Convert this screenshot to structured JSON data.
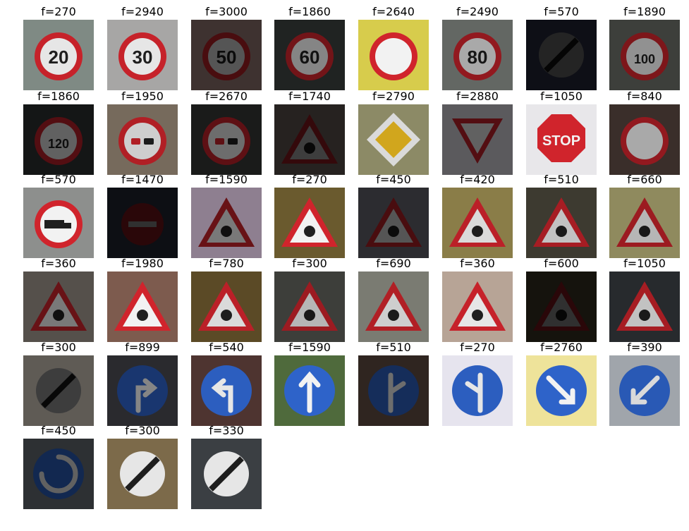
{
  "figure": {
    "images": [
      {
        "label": "f=270",
        "sign": "speed-limit-20",
        "text": "20",
        "bg": "#7f8a84",
        "light": 0.95
      },
      {
        "label": "f=2940",
        "sign": "speed-limit-30",
        "text": "30",
        "bg": "#a7a6a5",
        "light": 0.95
      },
      {
        "label": "f=3000",
        "sign": "speed-limit-50",
        "text": "50",
        "bg": "#3e3230",
        "light": 0.35
      },
      {
        "label": "f=1860",
        "sign": "speed-limit-60",
        "text": "60",
        "bg": "#202322",
        "light": 0.55
      },
      {
        "label": "f=2640",
        "sign": "speed-limit-70",
        "text": "",
        "bg": "#d7cc4c",
        "light": 1.0
      },
      {
        "label": "f=2490",
        "sign": "speed-limit-80",
        "text": "80",
        "bg": "#636763",
        "light": 0.7
      },
      {
        "label": "f=570",
        "sign": "end-speed-limit",
        "text": "",
        "bg": "#0e0f16",
        "light": 0.15
      },
      {
        "label": "f=1890",
        "sign": "speed-limit-100",
        "text": "100",
        "bg": "#3d3f3b",
        "light": 0.6
      },
      {
        "label": "f=1860",
        "sign": "speed-limit-120",
        "text": "120",
        "bg": "#141616",
        "light": 0.4
      },
      {
        "label": "f=1950",
        "sign": "no-overtaking",
        "text": "",
        "bg": "#766a5c",
        "light": 0.85
      },
      {
        "label": "f=2670",
        "sign": "no-overtaking-trucks",
        "text": "",
        "bg": "#1a1b1a",
        "light": 0.45
      },
      {
        "label": "f=1740",
        "sign": "warning-triangle",
        "text": "",
        "bg": "#262220",
        "light": 0.25
      },
      {
        "label": "f=2790",
        "sign": "priority-road",
        "text": "",
        "bg": "#8c8a66",
        "light": 0.9
      },
      {
        "label": "f=2880",
        "sign": "yield",
        "text": "",
        "bg": "#5b5a5d",
        "light": 0.4
      },
      {
        "label": "f=1050",
        "sign": "stop",
        "text": "STOP",
        "bg": "#e8e7ea",
        "light": 1.0
      },
      {
        "label": "f=840",
        "sign": "no-vehicles",
        "text": "",
        "bg": "#3a2e2a",
        "light": 0.7
      },
      {
        "label": "f=570",
        "sign": "no-trucks",
        "text": "",
        "bg": "#8d8f8d",
        "light": 1.0
      },
      {
        "label": "f=1470",
        "sign": "no-entry",
        "text": "",
        "bg": "#0d0f14",
        "light": 0.2
      },
      {
        "label": "f=1590",
        "sign": "warning-triangle",
        "text": "",
        "bg": "#8e7f90",
        "light": 0.5
      },
      {
        "label": "f=270",
        "sign": "warning-triangle",
        "text": "",
        "bg": "#6a5a2e",
        "light": 1.0
      },
      {
        "label": "f=450",
        "sign": "warning-triangle",
        "text": "",
        "bg": "#2c2c30",
        "light": 0.35
      },
      {
        "label": "f=420",
        "sign": "warning-triangle",
        "text": "",
        "bg": "#8a7d48",
        "light": 0.9
      },
      {
        "label": "f=510",
        "sign": "warning-triangle",
        "text": "",
        "bg": "#3d3a30",
        "light": 0.8
      },
      {
        "label": "f=660",
        "sign": "warning-triangle",
        "text": "",
        "bg": "#8f8a5e",
        "light": 0.75
      },
      {
        "label": "f=360",
        "sign": "warning-triangle",
        "text": "",
        "bg": "#55504b",
        "light": 0.5
      },
      {
        "label": "f=1980",
        "sign": "warning-triangle",
        "text": "",
        "bg": "#7d5b4e",
        "light": 1.0
      },
      {
        "label": "f=780",
        "sign": "warning-triangle",
        "text": "",
        "bg": "#5b4a26",
        "light": 0.9
      },
      {
        "label": "f=300",
        "sign": "warning-triangle",
        "text": "",
        "bg": "#3d3e3a",
        "light": 0.75
      },
      {
        "label": "f=690",
        "sign": "warning-triangle",
        "text": "",
        "bg": "#7a7b72",
        "light": 0.85
      },
      {
        "label": "f=360",
        "sign": "warning-triangle",
        "text": "",
        "bg": "#b7a496",
        "light": 0.95
      },
      {
        "label": "f=600",
        "sign": "warning-triangle",
        "text": "",
        "bg": "#15130d",
        "light": 0.2
      },
      {
        "label": "f=1050",
        "sign": "warning-triangle",
        "text": "",
        "bg": "#272a2d",
        "light": 0.8
      },
      {
        "label": "f=300",
        "sign": "end-restrictions",
        "text": "",
        "bg": "#5f5b55",
        "light": 0.25
      },
      {
        "label": "f=899",
        "sign": "blue-turn-right",
        "text": "",
        "bg": "#2a2a2e",
        "light": 0.55
      },
      {
        "label": "f=540",
        "sign": "blue-turn-left",
        "text": "",
        "bg": "#4e3430",
        "light": 0.95
      },
      {
        "label": "f=1590",
        "sign": "blue-straight",
        "text": "",
        "bg": "#4f6a3c",
        "light": 1.0
      },
      {
        "label": "f=510",
        "sign": "blue-straight-right",
        "text": "",
        "bg": "#2f2520",
        "light": 0.45
      },
      {
        "label": "f=270",
        "sign": "blue-straight-left",
        "text": "",
        "bg": "#e6e4ee",
        "light": 0.95
      },
      {
        "label": "f=2760",
        "sign": "blue-keep-right",
        "text": "",
        "bg": "#eee39a",
        "light": 1.0
      },
      {
        "label": "f=390",
        "sign": "blue-keep-left",
        "text": "",
        "bg": "#a0a5ab",
        "light": 0.9
      },
      {
        "label": "f=450",
        "sign": "blue-roundabout",
        "text": "",
        "bg": "#2d3033",
        "light": 0.4
      },
      {
        "label": "f=300",
        "sign": "end-no-overtaking",
        "text": "",
        "bg": "#7c6a4a",
        "light": 0.95
      },
      {
        "label": "f=330",
        "sign": "end-no-overtaking-trucks",
        "text": "",
        "bg": "#3b3f43",
        "light": 0.95
      }
    ]
  }
}
